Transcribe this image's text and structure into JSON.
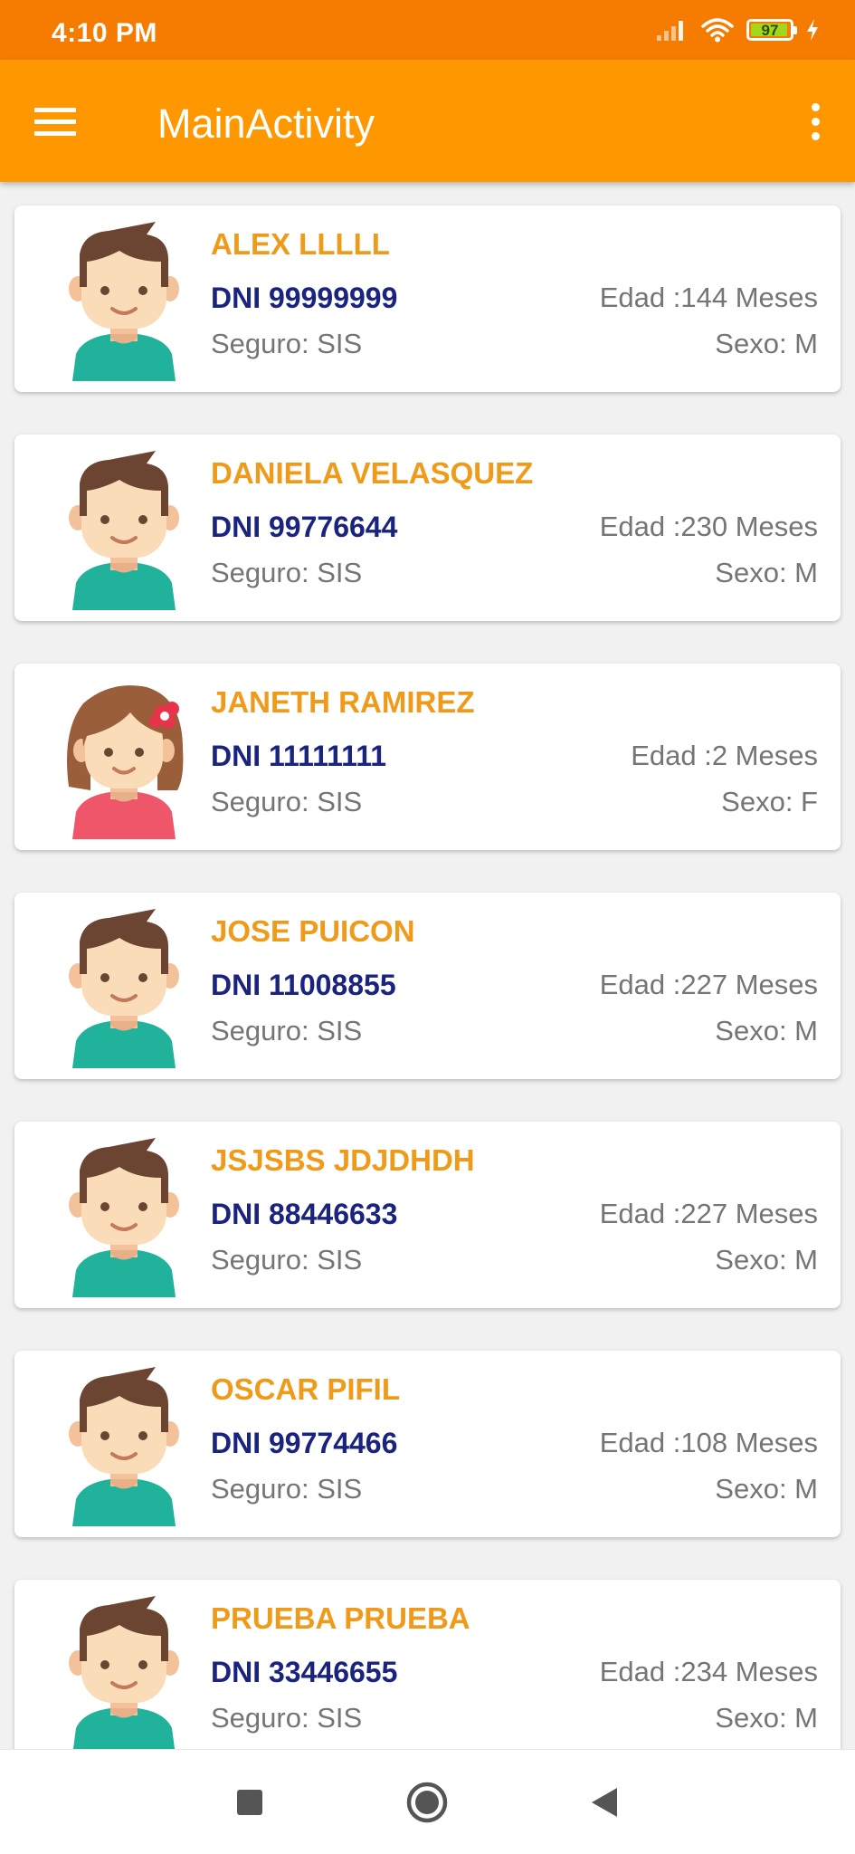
{
  "status_bar": {
    "time": "4:10 PM",
    "battery_level": "97",
    "icons": [
      "signal-icon",
      "wifi-icon",
      "battery-icon",
      "charging-icon"
    ]
  },
  "app_bar": {
    "title": "MainActivity",
    "menu_icon": "hamburger-menu-icon",
    "overflow_icon": "more-vert-icon"
  },
  "colors": {
    "status_bar": "#f57c00",
    "app_bar": "#ff9800",
    "name_text": "#f09a1a",
    "dni_text": "#1a237e",
    "secondary_text": "#757575"
  },
  "patients": [
    {
      "name": "ALEX LLLLL",
      "dni": "DNI 99999999",
      "edad": "Edad :144 Meses",
      "seguro": "Seguro: SIS",
      "sexo": "Sexo: M",
      "avatar": "boy-avatar-icon"
    },
    {
      "name": "DANIELA VELASQUEZ",
      "dni": "DNI 99776644",
      "edad": "Edad :230 Meses",
      "seguro": "Seguro: SIS",
      "sexo": "Sexo: M",
      "avatar": "boy-avatar-icon"
    },
    {
      "name": "JANETH RAMIREZ",
      "dni": "DNI 11111111",
      "edad": "Edad :2 Meses",
      "seguro": "Seguro: SIS",
      "sexo": "Sexo: F",
      "avatar": "girl-avatar-icon"
    },
    {
      "name": "JOSE PUICON",
      "dni": "DNI 11008855",
      "edad": "Edad :227 Meses",
      "seguro": "Seguro: SIS",
      "sexo": "Sexo: M",
      "avatar": "boy-avatar-icon"
    },
    {
      "name": "JSJSBS JDJDHDH",
      "dni": "DNI 88446633",
      "edad": "Edad :227 Meses",
      "seguro": "Seguro: SIS",
      "sexo": "Sexo: M",
      "avatar": "boy-avatar-icon"
    },
    {
      "name": "OSCAR PIFIL",
      "dni": "DNI 99774466",
      "edad": "Edad :108 Meses",
      "seguro": "Seguro: SIS",
      "sexo": "Sexo: M",
      "avatar": "boy-avatar-icon"
    },
    {
      "name": "PRUEBA PRUEBA",
      "dni": "DNI 33446655",
      "edad": "Edad :234 Meses",
      "seguro": "Seguro: SIS",
      "sexo": "Sexo: M",
      "avatar": "boy-avatar-icon"
    }
  ],
  "nav_bar": {
    "buttons": [
      "recents-square-icon",
      "home-circle-icon",
      "back-triangle-icon"
    ]
  }
}
